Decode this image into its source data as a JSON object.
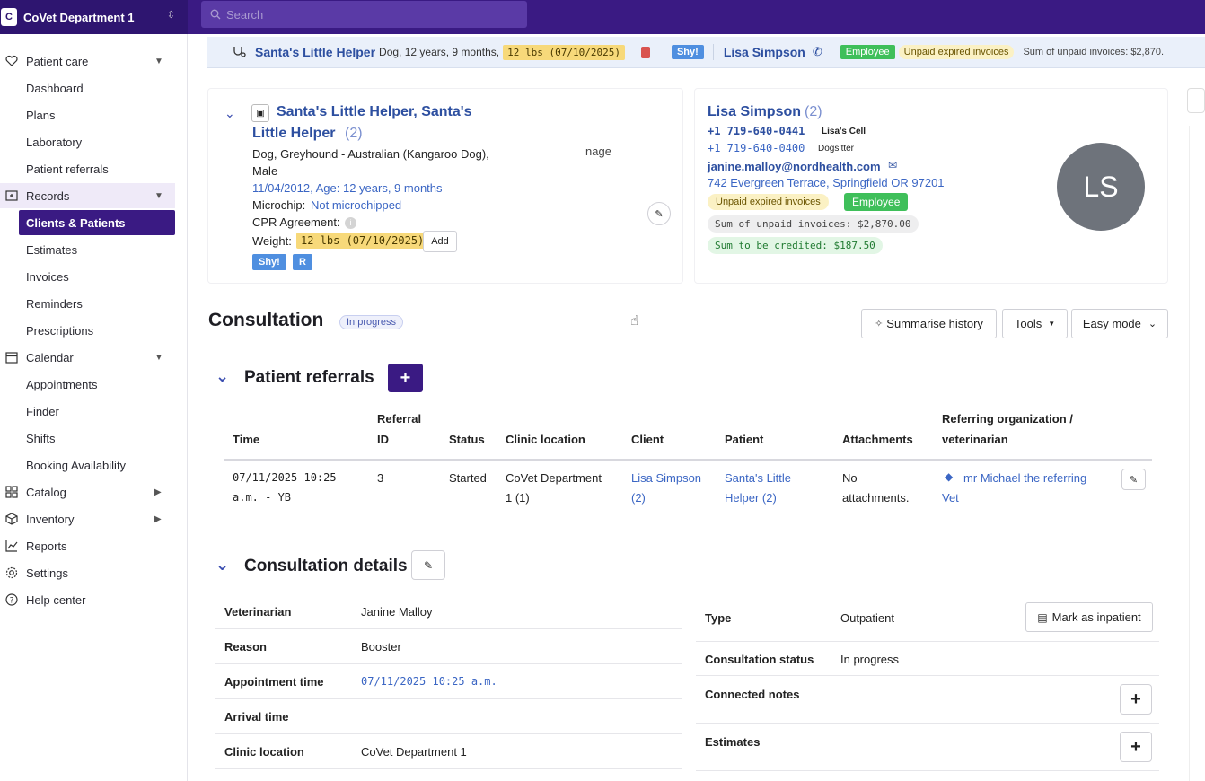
{
  "org": {
    "logo": "C",
    "name": "CoVet Department 1"
  },
  "search": {
    "placeholder": "Search"
  },
  "sidebar": {
    "patient_care": "Patient care",
    "dashboard": "Dashboard",
    "plans": "Plans",
    "laboratory": "Laboratory",
    "patient_referrals": "Patient referrals",
    "records": "Records",
    "clients_patients": "Clients & Patients",
    "estimates": "Estimates",
    "invoices": "Invoices",
    "reminders": "Reminders",
    "prescriptions": "Prescriptions",
    "calendar": "Calendar",
    "appointments": "Appointments",
    "finder": "Finder",
    "shifts": "Shifts",
    "booking": "Booking Availability",
    "catalog": "Catalog",
    "inventory": "Inventory",
    "reports": "Reports",
    "settings": "Settings",
    "help": "Help center"
  },
  "strip": {
    "patient_name": "Santa's Little Helper",
    "patient_info": "Dog, 12 years, 9 months,",
    "weight": "12 lbs (07/10/2025)",
    "shy": "Shy!",
    "client_name": "Lisa Simpson",
    "employee": "Employee",
    "unpaid": "Unpaid expired invoices",
    "sum_unpaid": "Sum of unpaid invoices: $2,870."
  },
  "patient": {
    "title_line1": "Santa's Little Helper, Santa's",
    "title_line2": "Little Helper",
    "count": "(2)",
    "breed_line1": "Dog, Greyhound - Australian (Kangaroo Dog),",
    "breed_line2": "Male",
    "image_text": "nage",
    "dob": "11/04/2012, Age: 12 years, 9 months",
    "microchip_label": "Microchip:",
    "microchip_value": "Not microchipped",
    "cpr_label": "CPR Agreement:",
    "weight_label": "Weight:",
    "weight_value": "12 lbs (07/10/2025)",
    "add": "Add",
    "tag_shy": "Shy!",
    "tag_r": "R"
  },
  "client": {
    "name": "Lisa Simpson",
    "count": "(2)",
    "phone1": "+1 719-640-0441",
    "phone1_label": "Lisa's Cell",
    "phone2": "+1 719-640-0400",
    "phone2_label": "Dogsitter",
    "email": "janine.malloy@nordhealth.com",
    "address": "742 Evergreen Terrace, Springfield OR 97201",
    "unpaid": "Unpaid expired invoices",
    "employee": "Employee",
    "sum_unpaid": "Sum of unpaid invoices: $2,870.00",
    "sum_credit": "Sum to be credited: $187.50",
    "initials": "LS"
  },
  "consultation": {
    "title": "Consultation",
    "status": "In progress",
    "summarise": "Summarise history",
    "tools": "Tools",
    "mode": "Easy mode"
  },
  "referrals": {
    "title": "Patient referrals",
    "headers": {
      "time": "Time",
      "referral_1": "Referral",
      "referral_2": "ID",
      "status": "Status",
      "clinic": "Clinic location",
      "client": "Client",
      "patient": "Patient",
      "attachments": "Attachments",
      "referring_1": "Referring organization /",
      "referring_2": "veterinarian"
    },
    "row": {
      "time_1": "07/11/2025 10:25",
      "time_2": "a.m. - YB",
      "id": "3",
      "status": "Started",
      "clinic_1": "CoVet Department",
      "clinic_2": "1 (1)",
      "client_1": "Lisa Simpson",
      "client_2": "(2)",
      "patient_1": "Santa's Little",
      "patient_2": "Helper (2)",
      "attach_1": "No",
      "attach_2": "attachments.",
      "referring_1": "mr Michael the referring",
      "referring_2": "Vet"
    }
  },
  "details": {
    "title": "Consultation details",
    "vet_label": "Veterinarian",
    "vet_value": "Janine Malloy",
    "reason_label": "Reason",
    "reason_value": "Booster",
    "appt_label": "Appointment time",
    "appt_value": "07/11/2025 10:25 a.m.",
    "arrival_label": "Arrival time",
    "clinic_label": "Clinic location",
    "clinic_value": "CoVet Department 1",
    "type_label": "Type",
    "type_value": "Outpatient",
    "mark_inpatient": "Mark as inpatient",
    "status_label": "Consultation status",
    "status_value": "In progress",
    "notes_label": "Connected notes",
    "estimates_label": "Estimates"
  }
}
